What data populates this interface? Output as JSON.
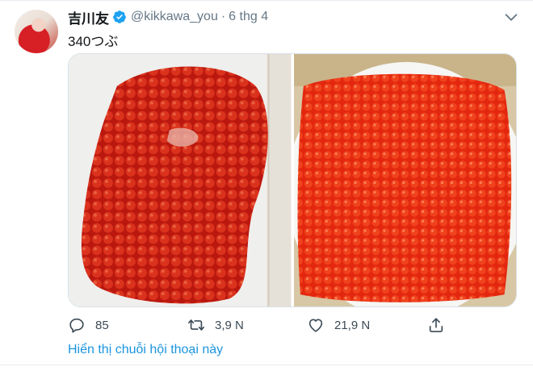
{
  "tweet": {
    "author_name": "吉川友",
    "author_handle": "@kikkawa_you",
    "separator": "·",
    "date": "6 thg 4",
    "text": "340つぶ",
    "verified": true
  },
  "actions": {
    "reply_count": "85",
    "retweet_count": "3,9 N",
    "like_count": "21,9 N"
  },
  "thread_link": "Hiển thị chuỗi hội thoại này",
  "icons": [
    "verified-badge-icon",
    "chevron-down-icon",
    "reply-icon",
    "retweet-icon",
    "like-icon",
    "share-icon"
  ],
  "colors": {
    "accent": "#1b95e0",
    "text": "#14171a",
    "secondary": "#657786",
    "roe": "#e8261a"
  }
}
